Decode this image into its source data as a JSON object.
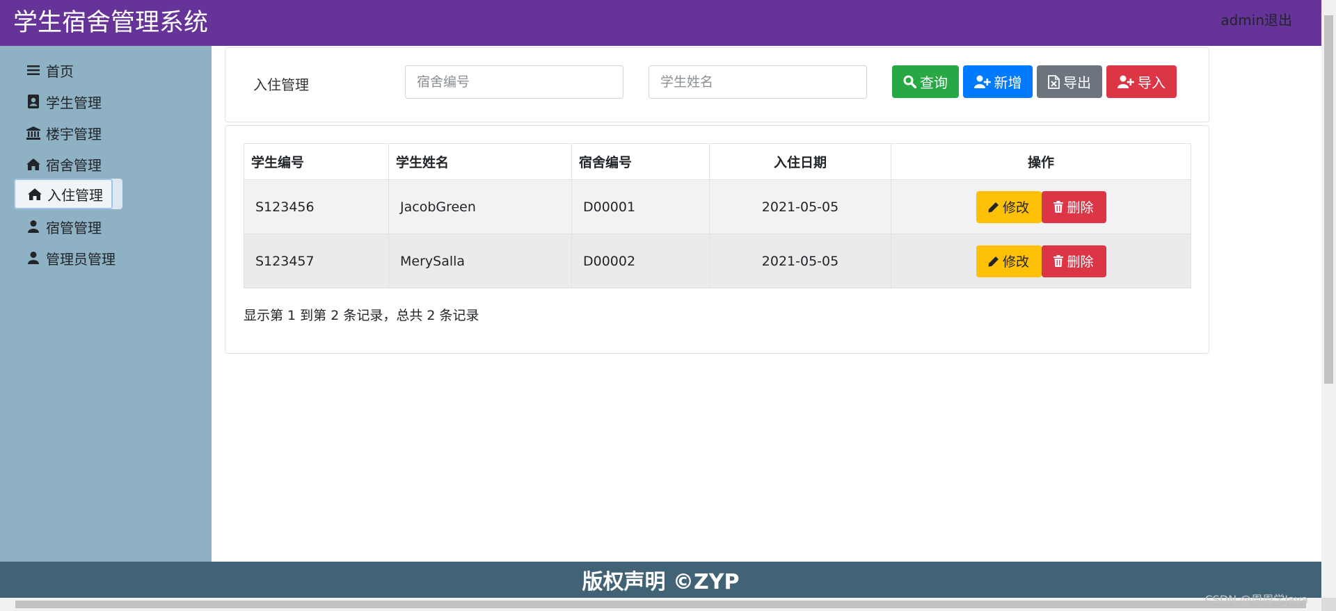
{
  "header": {
    "title": "学生宿舍管理系统",
    "user_link": "admin退出"
  },
  "sidebar": {
    "items": [
      {
        "label": "首页",
        "icon": "bars-icon"
      },
      {
        "label": "学生管理",
        "icon": "address-book-icon"
      },
      {
        "label": "楼宇管理",
        "icon": "institution-icon"
      },
      {
        "label": "宿舍管理",
        "icon": "home-icon"
      },
      {
        "label": "入住管理",
        "icon": "home-icon",
        "active": true
      },
      {
        "label": "宿管管理",
        "icon": "user-icon"
      },
      {
        "label": "管理员管理",
        "icon": "user-icon"
      }
    ]
  },
  "search": {
    "section_title": "入住管理",
    "dorm_placeholder": "宿舍编号",
    "name_placeholder": "学生姓名",
    "query_label": "查询",
    "add_label": "新增",
    "export_label": "导出",
    "import_label": "导入"
  },
  "table": {
    "headers": [
      "学生编号",
      "学生姓名",
      "宿舍编号",
      "入住日期",
      "操作"
    ],
    "rows": [
      {
        "student_id": "S123456",
        "student_name": "JacobGreen",
        "dorm_id": "D00001",
        "checkin_date": "2021-05-05"
      },
      {
        "student_id": "S123457",
        "student_name": "MerySalla",
        "dorm_id": "D00002",
        "checkin_date": "2021-05-05"
      }
    ],
    "edit_label": "修改",
    "delete_label": "删除"
  },
  "pagination": {
    "info": "显示第 1 到第 2 条记录，总共 2 条记录"
  },
  "footer": {
    "text": "版权声明 ©ZYP"
  },
  "watermark": "CSDN @周周学Java",
  "colors": {
    "header": "#663399",
    "sidebar": "#8fb1c4",
    "footer": "#426275",
    "success": "#28a745",
    "primary": "#007bff",
    "secondary": "#6c757d",
    "danger": "#dc3545",
    "warning": "#ffc107"
  }
}
